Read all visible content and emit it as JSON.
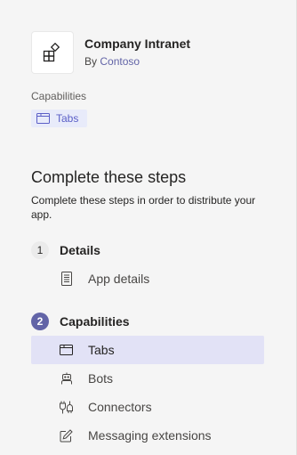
{
  "app": {
    "name": "Company Intranet",
    "publisher_prefix": "By",
    "publisher": "Contoso",
    "icon": "app-grid-icon"
  },
  "capabilities": {
    "label": "Capabilities",
    "chip_label": "Tabs",
    "chip_icon": "tab-window-icon"
  },
  "steps_section": {
    "title": "Complete these steps",
    "description": "Complete these steps in order to distribute your app."
  },
  "steps": [
    {
      "number": "1",
      "title": "Details",
      "active": false,
      "items": [
        {
          "label": "App details",
          "icon": "document-icon",
          "selected": false
        }
      ]
    },
    {
      "number": "2",
      "title": "Capabilities",
      "active": true,
      "items": [
        {
          "label": "Tabs",
          "icon": "tab-window-icon",
          "selected": true
        },
        {
          "label": "Bots",
          "icon": "bot-icon",
          "selected": false
        },
        {
          "label": "Connectors",
          "icon": "connector-plug-icon",
          "selected": false
        },
        {
          "label": "Messaging extensions",
          "icon": "edit-pencil-icon",
          "selected": false
        }
      ]
    }
  ],
  "colors": {
    "accent": "#6264a7",
    "chip_bg": "#e8ebfa",
    "selected_bg": "#e2e2f6",
    "panel_bg": "#f5f5f5"
  }
}
